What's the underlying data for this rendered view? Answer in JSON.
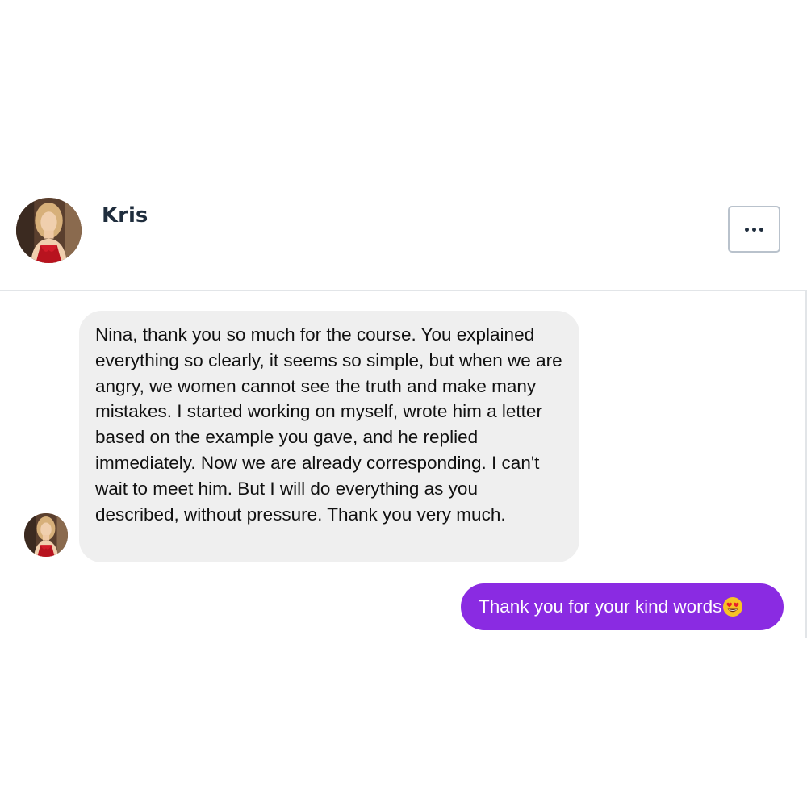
{
  "contact": {
    "name": "Kris"
  },
  "messages": [
    {
      "direction": "incoming",
      "text": "Nina, thank you so much for the course. You explained everything so clearly, it seems so simple, but when we are angry, we women cannot see the truth and make many mistakes. I started working on myself, wrote him a letter based on the example you gave, and he replied immediately. Now we are already corresponding. I can't wait to meet him. But I will do everything as you described, without pressure. Thank you very much."
    },
    {
      "direction": "outgoing",
      "text": "Thank you for your kind words",
      "emoji": "heart-eyes-emoji"
    }
  ],
  "colors": {
    "outgoing_bubble": "#8a2be2",
    "incoming_bubble": "#efefef",
    "name_text": "#1f2d3d"
  },
  "icons": {
    "more": "ellipsis-icon"
  }
}
